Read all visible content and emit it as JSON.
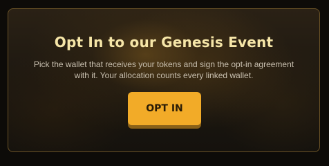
{
  "modal": {
    "title": "Opt In to our Genesis Event",
    "description_line1": "Pick the wallet that receives your tokens and sign the opt-in agreement",
    "description_line2": "with it. Your allocation counts every linked wallet.",
    "button_label": "OPT IN"
  },
  "colors": {
    "accent": "#f2ab28",
    "title": "#f6e6a8",
    "border": "#6b5327"
  }
}
